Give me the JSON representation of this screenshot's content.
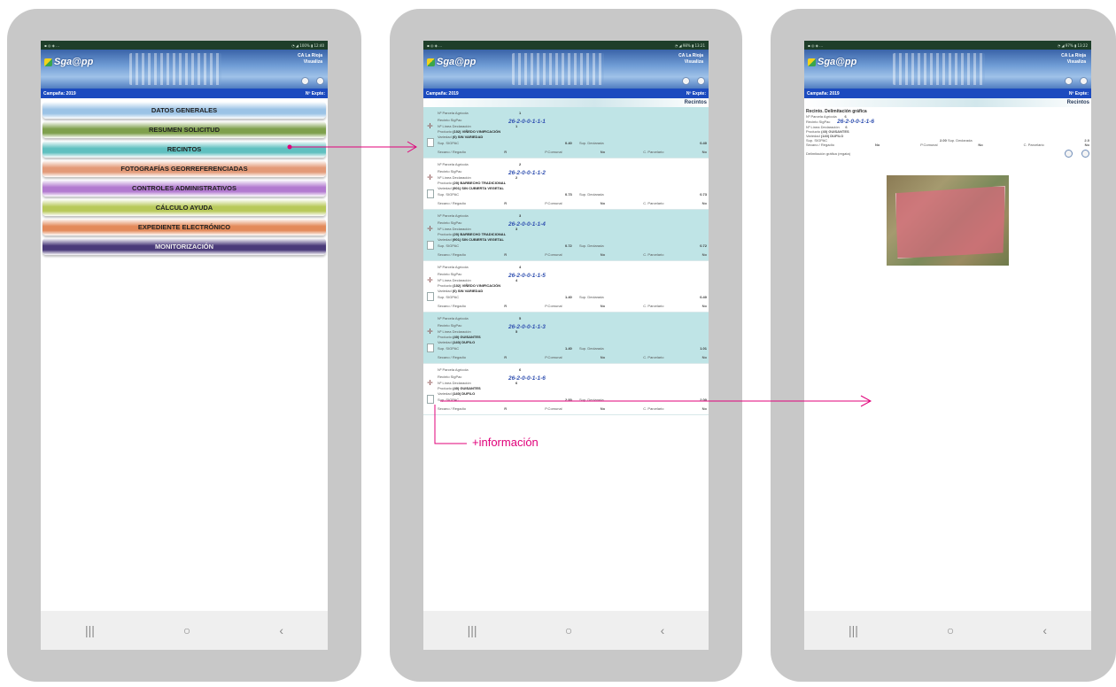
{
  "app": {
    "title": "Sga@pp",
    "region_line1": "CA La Rioja",
    "region_line2": "Visualiza",
    "campaign": "Campaña: 2019",
    "expediente": "Nº Expte:"
  },
  "screen1": {
    "menu": [
      {
        "label": "DATOS GENERALES",
        "color": "#9cc3e6"
      },
      {
        "label": "RESUMEN SOLICITUD",
        "color": "#7fa04c"
      },
      {
        "label": "RECINTOS",
        "color": "#5fc0c0"
      },
      {
        "label": "FOTOGRAFÍAS GEORREFERENCIADAS",
        "color": "#e39a78"
      },
      {
        "label": "CONTROLES ADMINISTRATIVOS",
        "color": "#b27ad0"
      },
      {
        "label": "CÁLCULO AYUDA",
        "color": "#b8c95a"
      },
      {
        "label": "EXPEDIENTE ELECTRÓNICO",
        "color": "#e38a5a"
      },
      {
        "label": "MONITORIZACIÓN",
        "color": "#4a3a7a"
      }
    ]
  },
  "screen2": {
    "section_title": "Recintos",
    "labels": {
      "parcela": "Nº Parcela Agrícola",
      "recinto": "Recinto SigPac",
      "linea": "Nº Línea Declaración",
      "producto": "Producto",
      "variedad": "Variedad",
      "sup_sigpac": "Sup. SIGPAC",
      "sup_declarada": "Sup. Declarada",
      "secano": "Secano / Regadío",
      "comunal": "P.Comunal",
      "parcelario": "C. Parcelario"
    },
    "records": [
      {
        "parcela": "1",
        "code": "26-2-0-0-1-1-1",
        "linea": "1",
        "producto": "(102) VIÑEDO VINIFICACIÓN",
        "variedad": "(0) SIN VARIEDAD",
        "sup_sigpac": "0.40",
        "secano": "R",
        "comunal": "No",
        "parcelario": "No",
        "sup_declarada": "0.40"
      },
      {
        "parcela": "2",
        "code": "26-2-0-0-1-1-2",
        "linea": "2",
        "producto": "(20) BARBECHO TRADICIONAL",
        "variedad": "(901) SIN CUBIERTA VEGETAL",
        "sup_sigpac": "0.73",
        "secano": "R",
        "comunal": "No",
        "parcelario": "No",
        "sup_declarada": "0.73"
      },
      {
        "parcela": "3",
        "code": "26-2-0-0-1-1-4",
        "linea": "3",
        "producto": "(20) BARBECHO TRADICIONAL",
        "variedad": "(901) SIN CUBIERTA VEGETAL",
        "sup_sigpac": "0.72",
        "secano": "R",
        "comunal": "No",
        "parcelario": "No",
        "sup_declarada": "0.72"
      },
      {
        "parcela": "4",
        "code": "26-2-0-0-1-1-5",
        "linea": "4",
        "producto": "(102) VIÑEDO VINIFICACIÓN",
        "variedad": "(0) SIN VARIEDAD",
        "sup_sigpac": "1.40",
        "secano": "R",
        "comunal": "No",
        "parcelario": "No",
        "sup_declarada": "0.40"
      },
      {
        "parcela": "5",
        "code": "26-2-0-0-1-1-3",
        "linea": "5",
        "producto": "(40) GUISANTES",
        "variedad": "(140) DUFILO",
        "sup_sigpac": "1.40",
        "secano": "R",
        "comunal": "No",
        "parcelario": "No",
        "sup_declarada": "1.01"
      },
      {
        "parcela": "6",
        "code": "26-2-0-0-1-1-6",
        "linea": "6",
        "producto": "(40) GUISANTES",
        "variedad": "(140) DUFILO",
        "sup_sigpac": "2.00",
        "secano": "R",
        "comunal": "No",
        "parcelario": "No",
        "sup_declarada": "2.00"
      }
    ],
    "callout": "+información"
  },
  "screen3": {
    "section_title": "Recintos",
    "header": "Recinto. Delimitación gráfica",
    "parcela": "6",
    "code": "26-2-0-0-1-1-6",
    "linea": "6",
    "producto": "(40) GUISANTES",
    "variedad": "(140) DUFILO",
    "sup_sigpac": "2.00",
    "secano": "No",
    "comunal": "No",
    "parcelario": "No",
    "sup_declarada": "2.0",
    "map_label": "Delimitación gráfica (regata)"
  },
  "colors": {
    "connector": "#e0007a",
    "campaign_bar": "#1c4bbf",
    "teal_row": "#bfe4e6",
    "phone_frame": "#c8c8c8"
  },
  "icons": {
    "nav_recents": "|||",
    "nav_home": "○",
    "nav_back": "‹"
  }
}
